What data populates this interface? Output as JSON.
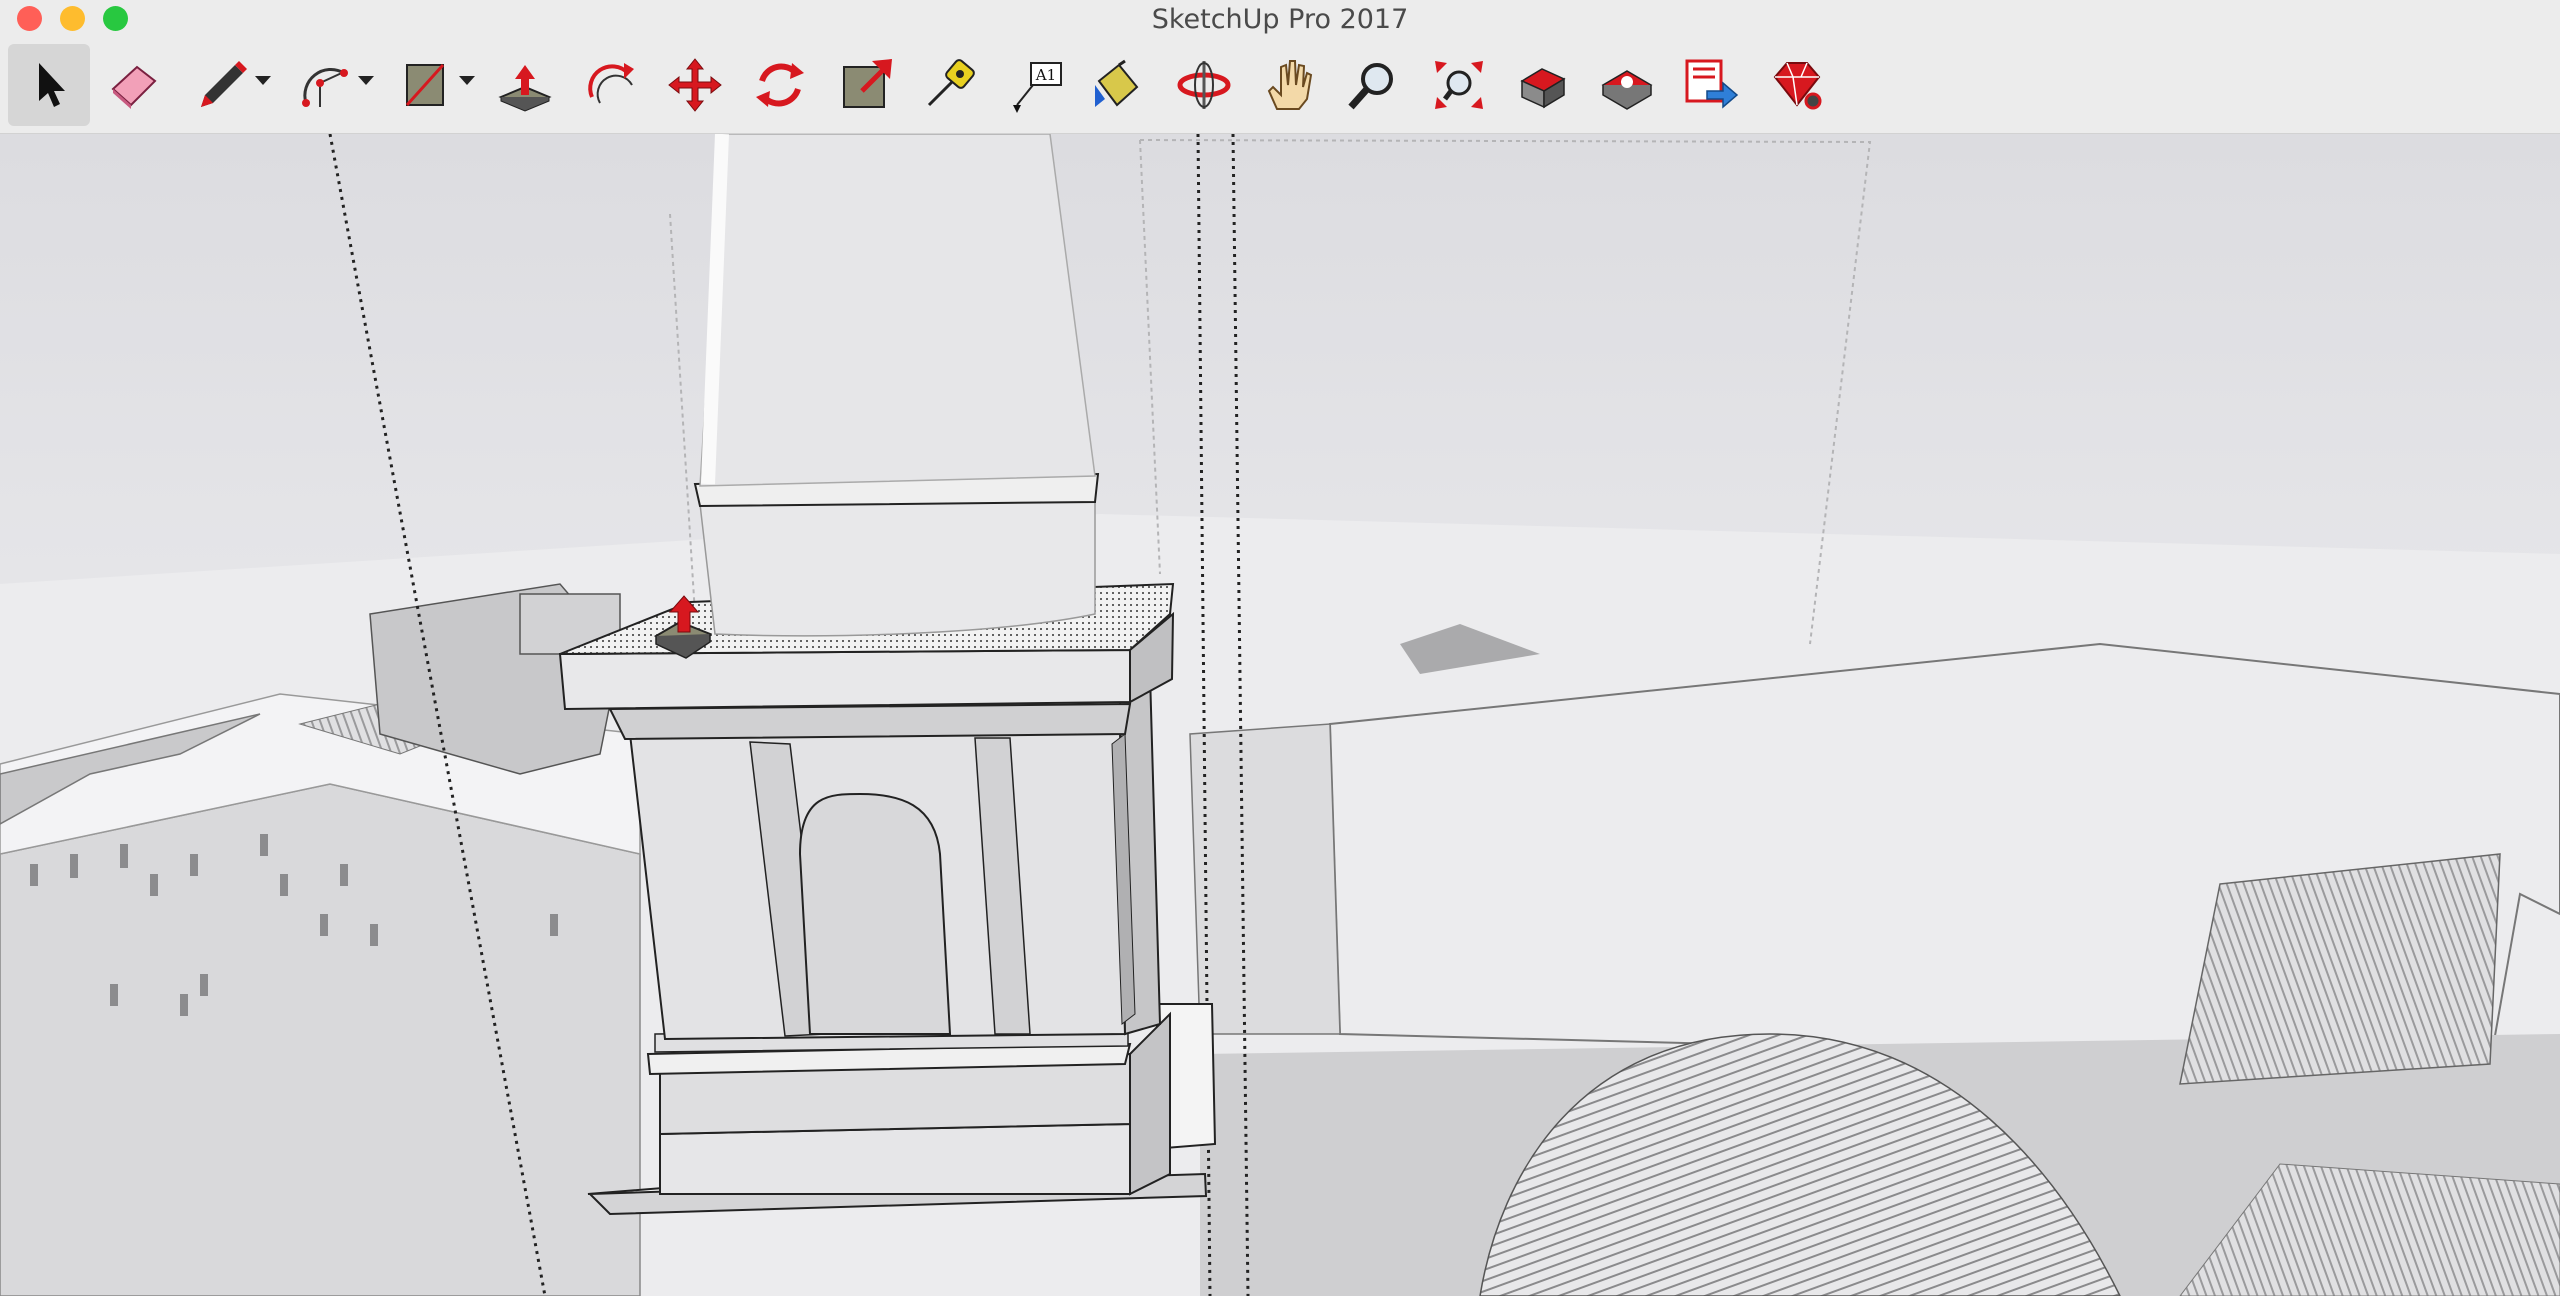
{
  "window": {
    "title": "SketchUp Pro 2017"
  },
  "toolbar": {
    "tools": [
      {
        "id": "select",
        "icon": "arrow-cursor-icon"
      },
      {
        "id": "eraser",
        "icon": "eraser-icon"
      },
      {
        "id": "line",
        "icon": "pencil-icon",
        "dropdown": true
      },
      {
        "id": "arc",
        "icon": "arc-icon",
        "dropdown": true
      },
      {
        "id": "rectangle",
        "icon": "rectangle-icon",
        "dropdown": true
      },
      {
        "id": "push-pull",
        "icon": "push-pull-icon"
      },
      {
        "id": "offset",
        "icon": "offset-icon"
      },
      {
        "id": "move",
        "icon": "move-icon"
      },
      {
        "id": "rotate",
        "icon": "rotate-icon"
      },
      {
        "id": "scale",
        "icon": "scale-icon"
      },
      {
        "id": "tape-measure",
        "icon": "tape-measure-icon"
      },
      {
        "id": "text",
        "icon": "text-label-icon",
        "label": "A1"
      },
      {
        "id": "paint-bucket",
        "icon": "paint-bucket-icon"
      },
      {
        "id": "orbit",
        "icon": "orbit-icon"
      },
      {
        "id": "pan",
        "icon": "hand-icon"
      },
      {
        "id": "zoom",
        "icon": "magnifier-icon"
      },
      {
        "id": "zoom-extents",
        "icon": "zoom-extents-icon"
      },
      {
        "id": "warehouse",
        "icon": "3d-warehouse-icon"
      },
      {
        "id": "extension-warehouse",
        "icon": "extension-warehouse-icon"
      },
      {
        "id": "send-to-layout",
        "icon": "send-to-layout-icon"
      },
      {
        "id": "extension-manager",
        "icon": "extension-manager-icon"
      }
    ]
  },
  "colors": {
    "accent_red": "#d7181f",
    "titlebar": "#ececec",
    "sky": "#e6e6e9"
  }
}
